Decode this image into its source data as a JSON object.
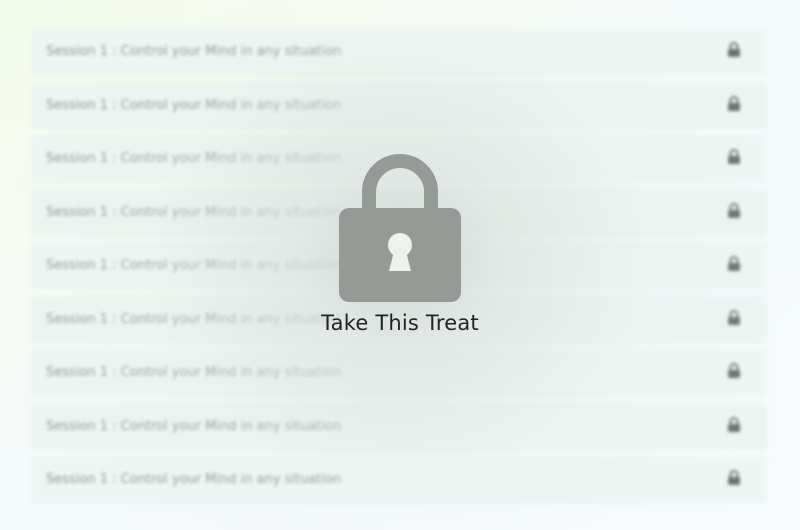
{
  "sessions": [
    {
      "title": "Session 1 : Control your Mind in any situation",
      "icon": "lock-icon"
    },
    {
      "title": "Session 1 : Control your Mind in any situation",
      "icon": "lock-icon"
    },
    {
      "title": "Session 1 : Control your Mind in any situation",
      "icon": "lock-icon"
    },
    {
      "title": "Session 1 : Control your Mind in any situation",
      "icon": "lock-icon"
    },
    {
      "title": "Session 1 : Control your Mind in any situation",
      "icon": "lock-icon"
    },
    {
      "title": "Session 1 : Control your Mind in any situation",
      "icon": "lock-icon"
    },
    {
      "title": "Session 1 : Control your Mind in any situation",
      "icon": "lock-icon"
    },
    {
      "title": "Session 1 : Control your Mind in any situation",
      "icon": "lock-icon"
    },
    {
      "title": "Session 1 : Control your Mind in any situation",
      "icon": "lock-icon"
    }
  ],
  "overlay": {
    "icon": "padlock-icon",
    "label": "Take This Treat"
  },
  "colors": {
    "lock": "#959a97",
    "row_lock": "#6d7270",
    "label": "#1f2321"
  }
}
